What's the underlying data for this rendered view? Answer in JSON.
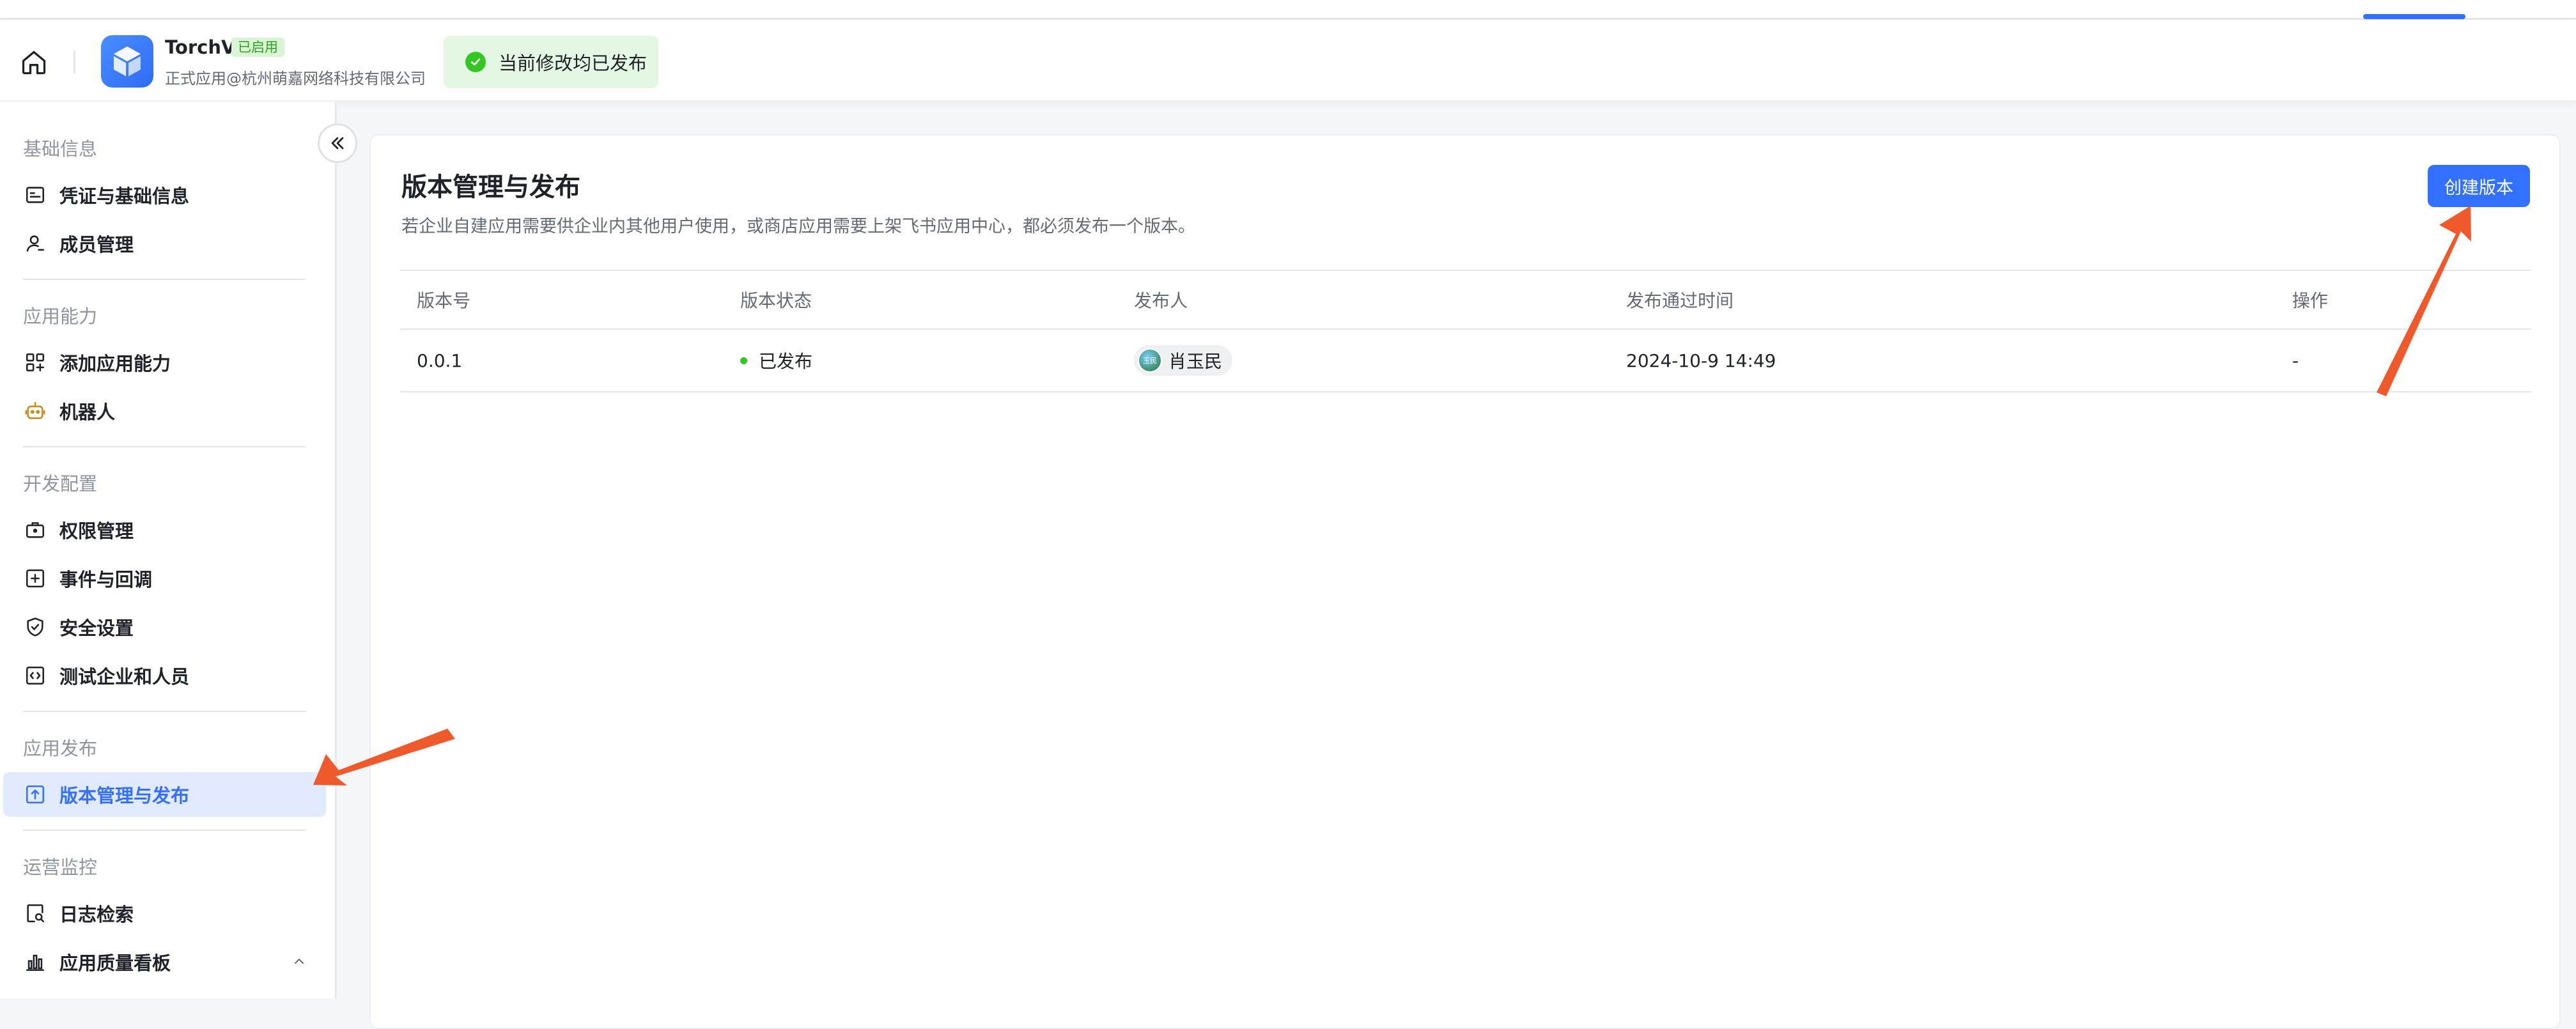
{
  "header": {
    "app_name": "TorchV",
    "app_status_badge": "已启用",
    "app_subtitle": "正式应用@杭州萌嘉网络科技有限公司",
    "toast_text": "当前修改均已发布"
  },
  "sidebar": {
    "sections": [
      {
        "title": "基础信息",
        "items": [
          "凭证与基础信息",
          "成员管理"
        ]
      },
      {
        "title": "应用能力",
        "items": [
          "添加应用能力",
          "机器人"
        ]
      },
      {
        "title": "开发配置",
        "items": [
          "权限管理",
          "事件与回调",
          "安全设置",
          "测试企业和人员"
        ]
      },
      {
        "title": "应用发布",
        "items": [
          "版本管理与发布"
        ]
      },
      {
        "title": "运营监控",
        "items": [
          "日志检索",
          "应用质量看板"
        ]
      }
    ],
    "active_item": "版本管理与发布"
  },
  "main": {
    "title": "版本管理与发布",
    "description": "若企业自建应用需要供企业内其他用户使用，或商店应用需要上架飞书应用中心，都必须发布一个版本。",
    "create_button": "创建版本",
    "table": {
      "headers": [
        "版本号",
        "版本状态",
        "发布人",
        "发布通过时间",
        "操作"
      ],
      "rows": [
        {
          "version": "0.0.1",
          "status": "已发布",
          "publisher": "肖玉民",
          "publisher_avatar_text": "玉民",
          "passed_time": "2024-10-9 14:49",
          "action": "-"
        }
      ]
    }
  },
  "colors": {
    "accent": "#3370ff",
    "success": "#34c724",
    "annotation_arrow": "#ee5a2c"
  }
}
